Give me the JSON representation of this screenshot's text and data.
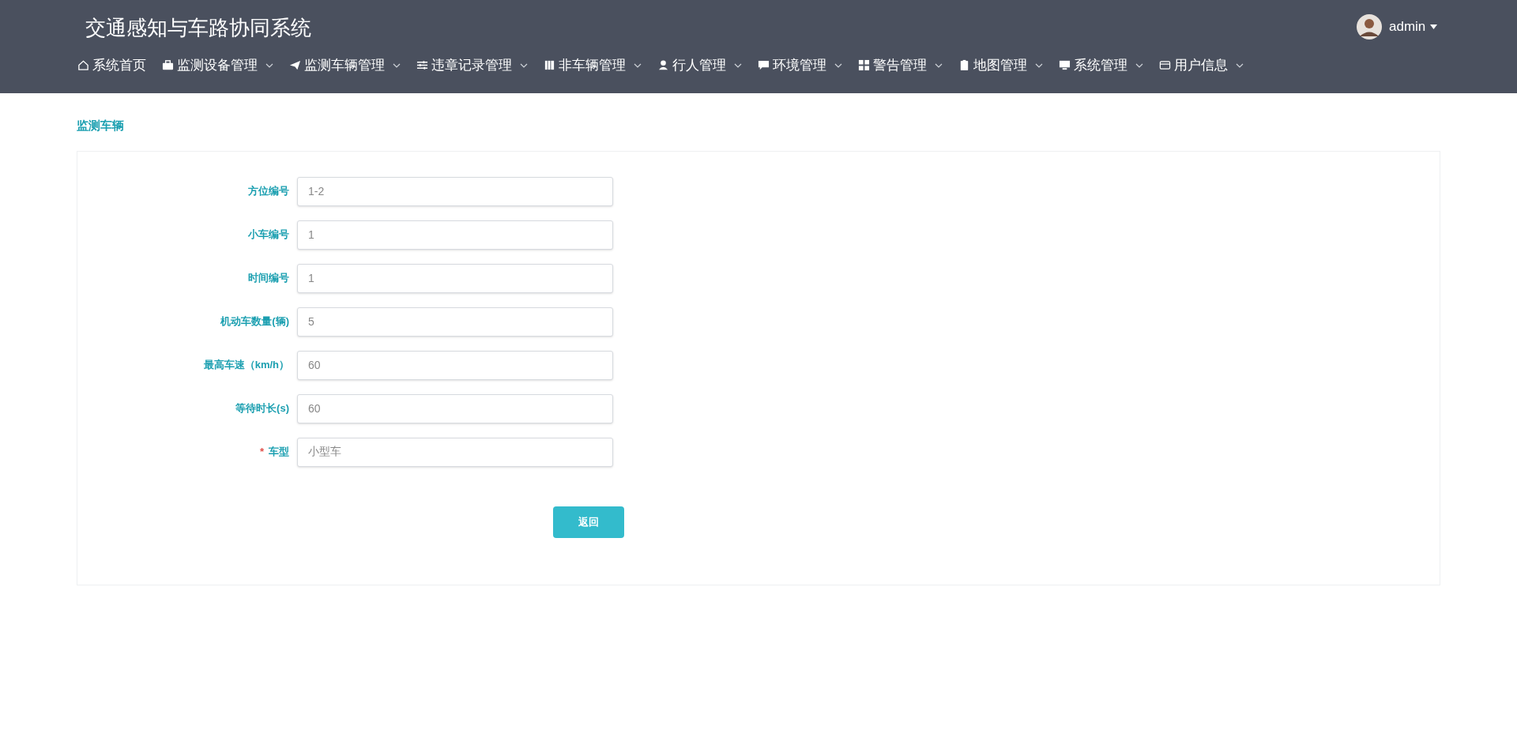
{
  "header": {
    "title": "交通感知与车路协同系统",
    "user": {
      "name": "admin"
    }
  },
  "nav": [
    {
      "label": "系统首页",
      "has_menu": false
    },
    {
      "label": "监测设备管理",
      "has_menu": true
    },
    {
      "label": "监测车辆管理",
      "has_menu": true
    },
    {
      "label": "违章记录管理",
      "has_menu": true
    },
    {
      "label": "非车辆管理",
      "has_menu": true
    },
    {
      "label": "行人管理",
      "has_menu": true
    },
    {
      "label": "环境管理",
      "has_menu": true
    },
    {
      "label": "警告管理",
      "has_menu": true
    },
    {
      "label": "地图管理",
      "has_menu": true
    },
    {
      "label": "系统管理",
      "has_menu": true
    },
    {
      "label": "用户信息",
      "has_menu": true
    }
  ],
  "page_title": "监测车辆",
  "form": {
    "fields": [
      {
        "label": "方位编号",
        "value": "1-2"
      },
      {
        "label": "小车编号",
        "value": "1"
      },
      {
        "label": "时间编号",
        "value": "1"
      },
      {
        "label": "机动车数量(辆)",
        "value": "5"
      },
      {
        "label": "最高车速（km/h）",
        "value": "60"
      },
      {
        "label": "等待时长(s)",
        "value": "60"
      },
      {
        "label": "车型",
        "value": "小型车",
        "required_mark": "*"
      }
    ],
    "buttons": [
      "返回"
    ]
  }
}
